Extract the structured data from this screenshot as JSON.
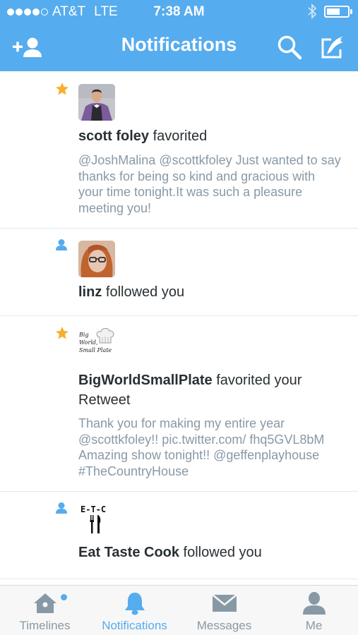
{
  "status_bar": {
    "carrier": "AT&T",
    "network": "LTE",
    "time": "7:38 AM"
  },
  "header": {
    "title": "Notifications"
  },
  "colors": {
    "accent": "#55acee",
    "star": "#f7ae2a",
    "muted": "#8899a6",
    "text": "#292f33"
  },
  "notifications": [
    {
      "type_icon": "star-icon",
      "user": "scott foley",
      "action": " favorited",
      "body": "@JoshMalina @scottkfoley Just wanted to say thanks for being so kind and gracious with your time tonight.It was such a pleasure meeting you!"
    },
    {
      "type_icon": "follow-icon",
      "user": "linz",
      "action": " followed you"
    },
    {
      "type_icon": "star-icon",
      "user": "BigWorldSmallPlate",
      "action": " favorited your Retweet",
      "avatar_text": [
        "Big",
        "World,",
        "Small Plate"
      ],
      "body": "Thank you for making my entire year @scottkfoley!! pic.twitter.com/ fhq5GVL8bM Amazing show tonight!! @geffenplayhouse #TheCountryHouse"
    },
    {
      "type_icon": "follow-icon",
      "user": "Eat Taste Cook",
      "action": " followed you",
      "avatar_text": "E-T-C"
    }
  ],
  "tabs": [
    {
      "label": "Timelines",
      "icon": "home-icon"
    },
    {
      "label": "Notifications",
      "icon": "bell-icon",
      "active": true
    },
    {
      "label": "Messages",
      "icon": "envelope-icon"
    },
    {
      "label": "Me",
      "icon": "person-icon"
    }
  ]
}
